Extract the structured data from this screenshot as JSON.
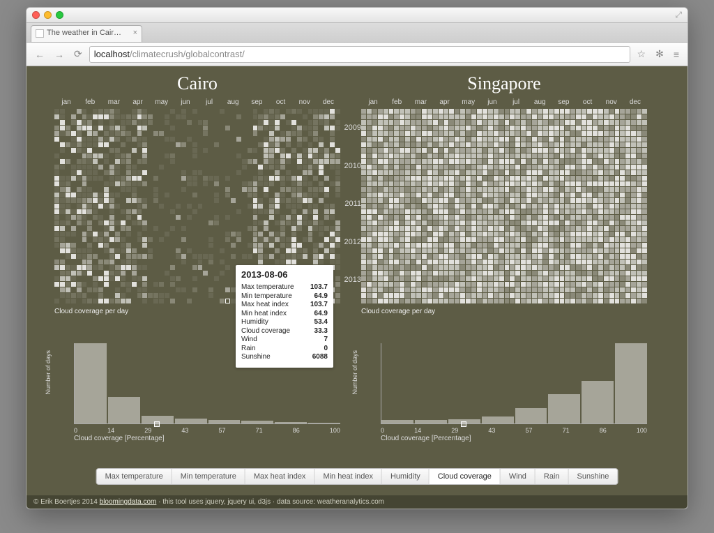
{
  "browser": {
    "tab_title": "The weather in Cairo vs Sin…",
    "url_host": "localhost",
    "url_path": "/climatecrush/globalcontrast/",
    "back_glyph": "←",
    "forward_glyph": "→",
    "reload_glyph": "⟳",
    "star_glyph": "☆",
    "ext_glyph": "✻",
    "menu_glyph": "≡",
    "expand_glyph": "⤢",
    "close_glyph": "×"
  },
  "cities": {
    "left": "Cairo",
    "right": "Singapore"
  },
  "months": [
    "jan",
    "feb",
    "mar",
    "apr",
    "may",
    "jun",
    "jul",
    "aug",
    "sep",
    "oct",
    "nov",
    "dec"
  ],
  "years": [
    "2009",
    "2010",
    "2011",
    "2012",
    "2013"
  ],
  "caption": "Cloud coverage per day",
  "tooltip": {
    "date": "2013-08-06",
    "rows": [
      {
        "label": "Max temperature",
        "value": "103.7"
      },
      {
        "label": "Min temperature",
        "value": "64.9"
      },
      {
        "label": "Max heat index",
        "value": "103.7"
      },
      {
        "label": "Min heat index",
        "value": "64.9"
      },
      {
        "label": "Humidity",
        "value": "53.4"
      },
      {
        "label": "Cloud coverage",
        "value": "33.3"
      },
      {
        "label": "Wind",
        "value": "7"
      },
      {
        "label": "Rain",
        "value": "0"
      },
      {
        "label": "Sunshine",
        "value": "6088"
      }
    ]
  },
  "chart_data": {
    "barcharts": [
      {
        "city": "Cairo",
        "type": "bar",
        "xlabel": "Cloud coverage [Percentage]",
        "ylabel": "Number of days",
        "categories": [
          "0",
          "14",
          "29",
          "43",
          "57",
          "71",
          "86",
          "100"
        ],
        "values": [
          980,
          320,
          90,
          60,
          45,
          35,
          20,
          10
        ],
        "marker_bin_index": 2,
        "marker_value": 33.3
      },
      {
        "city": "Singapore",
        "type": "bar",
        "xlabel": "Cloud coverage [Percentage]",
        "ylabel": "Number of days",
        "categories": [
          "0",
          "14",
          "29",
          "43",
          "57",
          "71",
          "86",
          "100"
        ],
        "values": [
          30,
          30,
          40,
          60,
          140,
          260,
          380,
          720
        ],
        "marker_bin_index": 2,
        "marker_value": 33.3
      }
    ],
    "heatmaps": {
      "type": "heatmap",
      "description": "Daily cloud coverage per calendar day, 2009–2013, 7 rows per week, ~52 columns per year, 5 year-bands stacked. Cairo is sparse/dark in summer, Singapore is uniformly bright.",
      "seeds": {
        "cairo": 11,
        "singapore": 47
      }
    }
  },
  "metrics": {
    "items": [
      "Max temperature",
      "Min temperature",
      "Max heat index",
      "Min heat index",
      "Humidity",
      "Cloud coverage",
      "Wind",
      "Rain",
      "Sunshine"
    ],
    "active_index": 5
  },
  "footer": {
    "copyright": "© Erik Boertjes 2014 ",
    "link_text": "bloomingdata.com",
    "rest": " · this tool uses jquery, jquery ui, d3js · data source: weatheranalytics.com"
  }
}
